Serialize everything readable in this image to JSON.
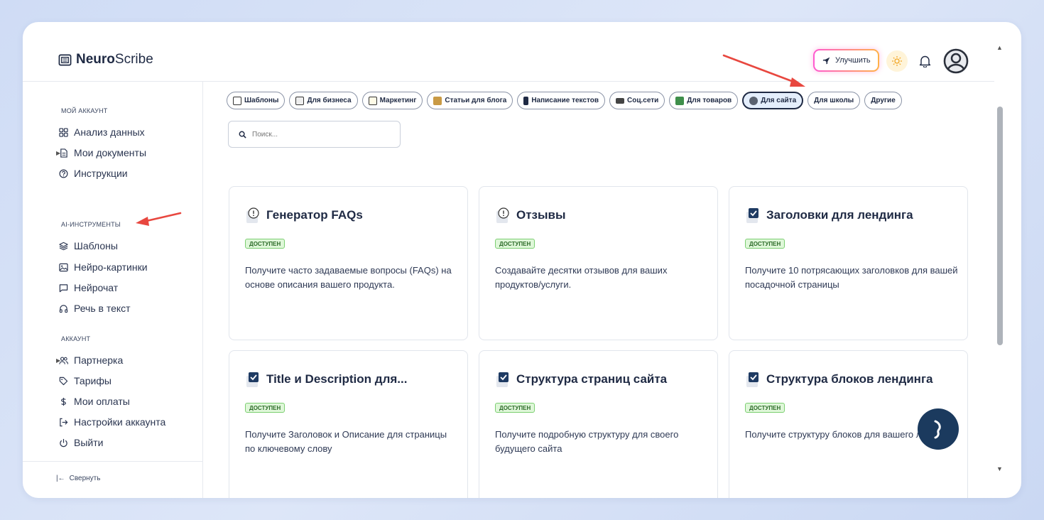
{
  "app": {
    "name_bold": "Neuro",
    "name_rest": "Scribe"
  },
  "header": {
    "upgrade_label": "Улучшить"
  },
  "sidebar": {
    "sections": [
      {
        "title": "МОЙ АККАУНТ",
        "items": [
          "Анализ данных",
          "Мои документы",
          "Инструкции"
        ]
      },
      {
        "title": "AI-ИНСТРУМЕНТЫ",
        "items": [
          "Шаблоны",
          "Нейро-картинки",
          "Нейрочат",
          "Речь в текст"
        ]
      },
      {
        "title": "АККАУНТ",
        "items": [
          "Партнерка",
          "Тарифы",
          "Мои оплаты",
          "Настройки аккаунта",
          "Выйти"
        ]
      }
    ],
    "collapse_label": "Свернуть"
  },
  "chips": [
    {
      "label": "Шаблоны",
      "icon": "template-icon",
      "active": false
    },
    {
      "label": "Для бизнеса",
      "icon": "briefcase-icon",
      "active": false
    },
    {
      "label": "Маркетинг",
      "icon": "memo-icon",
      "active": false
    },
    {
      "label": "Статьи для блога",
      "icon": "blog-icon",
      "active": false
    },
    {
      "label": "Написание текстов",
      "icon": "phone-icon",
      "active": false
    },
    {
      "label": "Соц.сети",
      "icon": "laptop-icon",
      "active": false
    },
    {
      "label": "Для товаров",
      "icon": "box-icon",
      "active": false
    },
    {
      "label": "Для сайта",
      "icon": "robot-icon",
      "active": true
    },
    {
      "label": "Для школы",
      "icon": "",
      "active": false
    },
    {
      "label": "Другие",
      "icon": "",
      "active": false
    }
  ],
  "search": {
    "placeholder": "Поиск..."
  },
  "cards": [
    {
      "title": "Генератор FAQs",
      "icon": "info-note-icon",
      "badge": "ДОСТУПЕН",
      "desc": "Получите часто задаваемые вопросы (FAQs) на основе описания вашего продукта."
    },
    {
      "title": "Отзывы",
      "icon": "info-note-icon",
      "badge": "ДОСТУПЕН",
      "desc": "Создавайте десятки отзывов для ваших продуктов/услуги."
    },
    {
      "title": "Заголовки для лендинга",
      "icon": "check-note-icon",
      "badge": "ДОСТУПЕН",
      "desc": "Получите 10 потрясающих заголовков для вашей посадочной страницы"
    },
    {
      "title": "Title и Description для...",
      "icon": "check-note-icon",
      "badge": "ДОСТУПЕН",
      "desc": "Получите Заголовок и Описание для страницы по ключевому слову"
    },
    {
      "title": "Структура страниц сайта",
      "icon": "check-note-icon",
      "badge": "ДОСТУПЕН",
      "desc": "Получите подробную структуру для своего будущего сайта"
    },
    {
      "title": "Структура блоков лендинга",
      "icon": "check-note-icon",
      "badge": "ДОСТУПЕН",
      "desc": "Получите структуру блоков для вашего лендинга"
    }
  ],
  "colors": {
    "accent": "#1f2a44",
    "badge_bg": "#dff7d9",
    "badge_border": "#7ccf72",
    "annotation_arrow": "#e8473f",
    "fab": "#1b3a5e"
  }
}
